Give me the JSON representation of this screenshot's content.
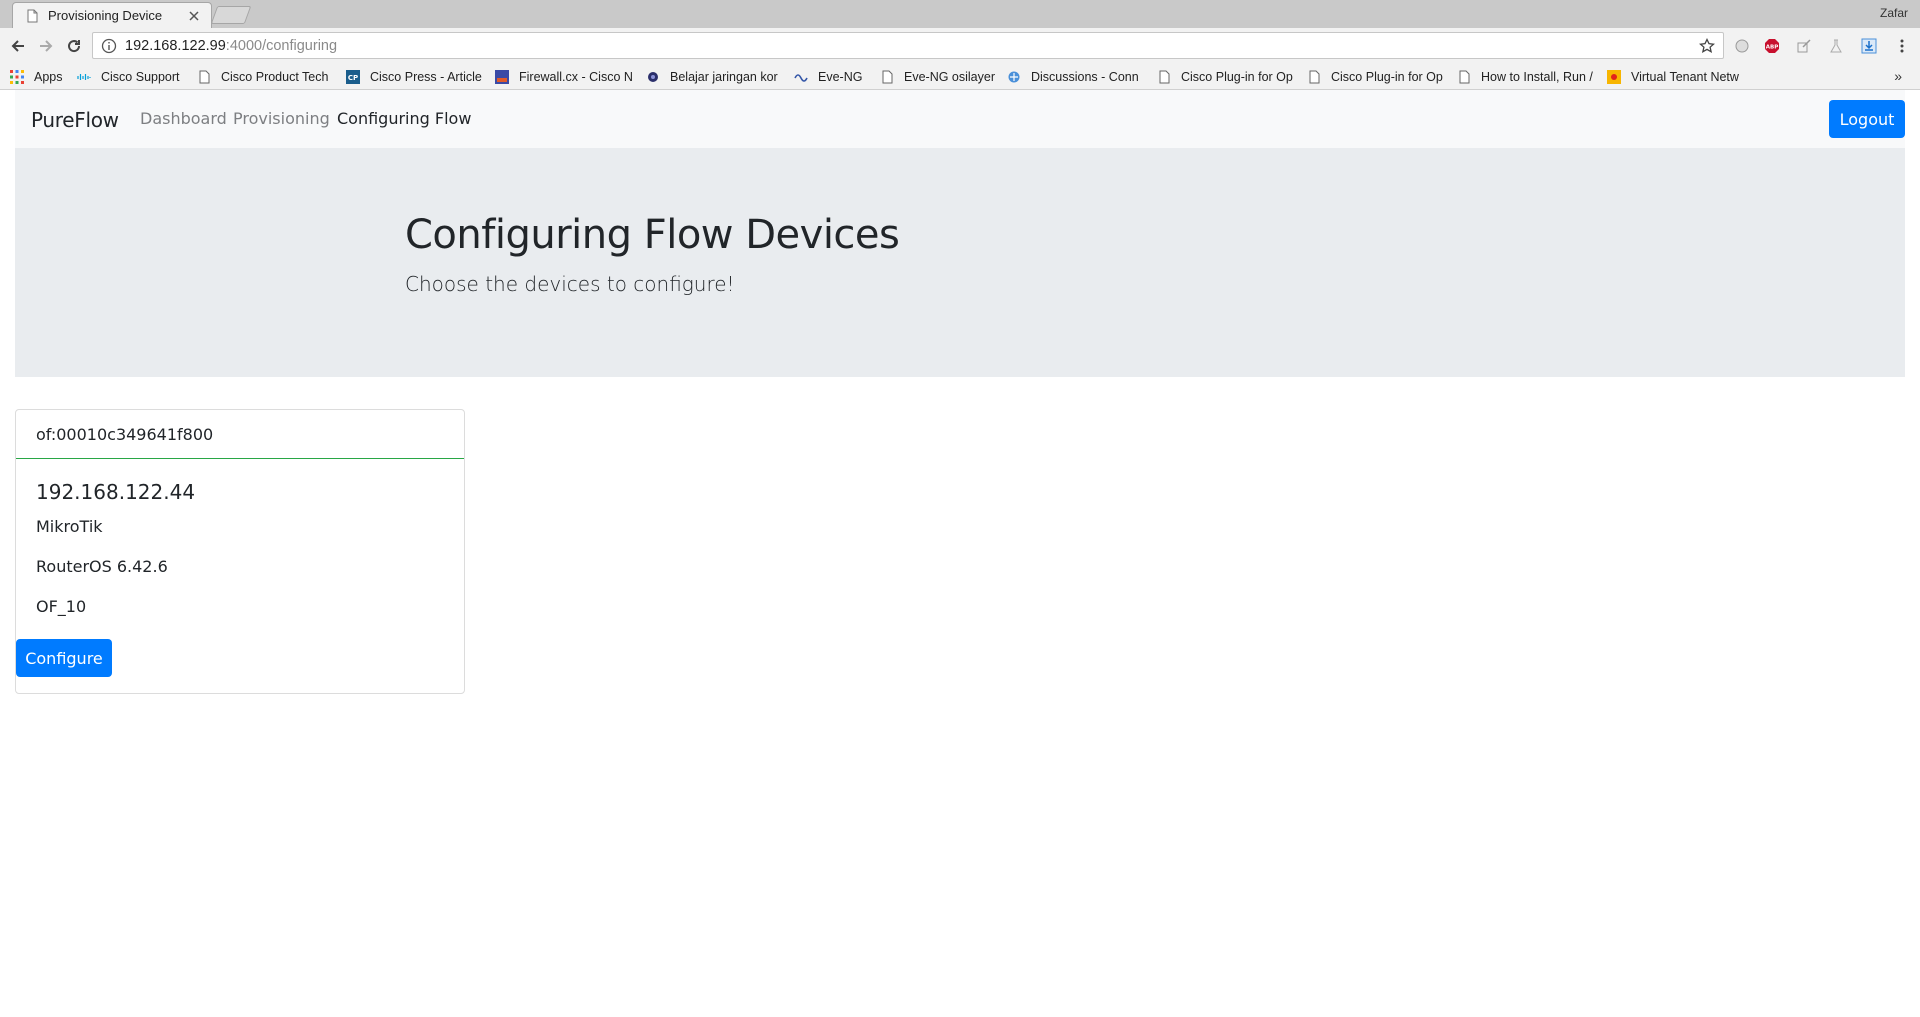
{
  "browser": {
    "tab_title": "Provisioning Device",
    "profile_name": "Zafar",
    "url_host": "192.168.122.99",
    "url_path": ":4000/configuring"
  },
  "bookmarks": {
    "apps": "Apps",
    "items": [
      {
        "label": "Cisco Support",
        "icon": "cisco-icon"
      },
      {
        "label": "Cisco Product Tech",
        "icon": "page-icon"
      },
      {
        "label": "Cisco Press - Article",
        "icon": "cp-icon"
      },
      {
        "label": "Firewall.cx - Cisco N",
        "icon": "firewall-icon"
      },
      {
        "label": "Belajar jaringan kor",
        "icon": "globe-icon"
      },
      {
        "label": "Eve-NG",
        "icon": "eve-icon"
      },
      {
        "label": "Eve-NG osilayer",
        "icon": "page-icon"
      },
      {
        "label": "Discussions - Conn",
        "icon": "discussions-icon"
      },
      {
        "label": "Cisco Plug-in for Op",
        "icon": "page-icon"
      },
      {
        "label": "Cisco Plug-in for Op",
        "icon": "page-icon"
      },
      {
        "label": "How to Install, Run /",
        "icon": "page-icon"
      },
      {
        "label": "Virtual Tenant Netw",
        "icon": "vtn-icon"
      }
    ],
    "more": "»"
  },
  "navbar": {
    "brand": "PureFlow",
    "links": [
      "Dashboard",
      "Provisioning",
      "Configuring Flow"
    ],
    "logout_label": "Logout"
  },
  "jumbotron": {
    "title": "Configuring Flow Devices",
    "lead": "Choose the devices to configure!"
  },
  "device_card": {
    "header": "of:00010c349641f800",
    "ip": "192.168.122.44",
    "manufacturer": "MikroTik",
    "software": "RouterOS 6.42.6",
    "protocol": "OF_10",
    "button_label": "Configure"
  },
  "colors": {
    "primary": "#007bff",
    "success_border": "#28a745",
    "jumbotron_bg": "#e9ecef",
    "navbar_bg": "#f8f9fa"
  }
}
